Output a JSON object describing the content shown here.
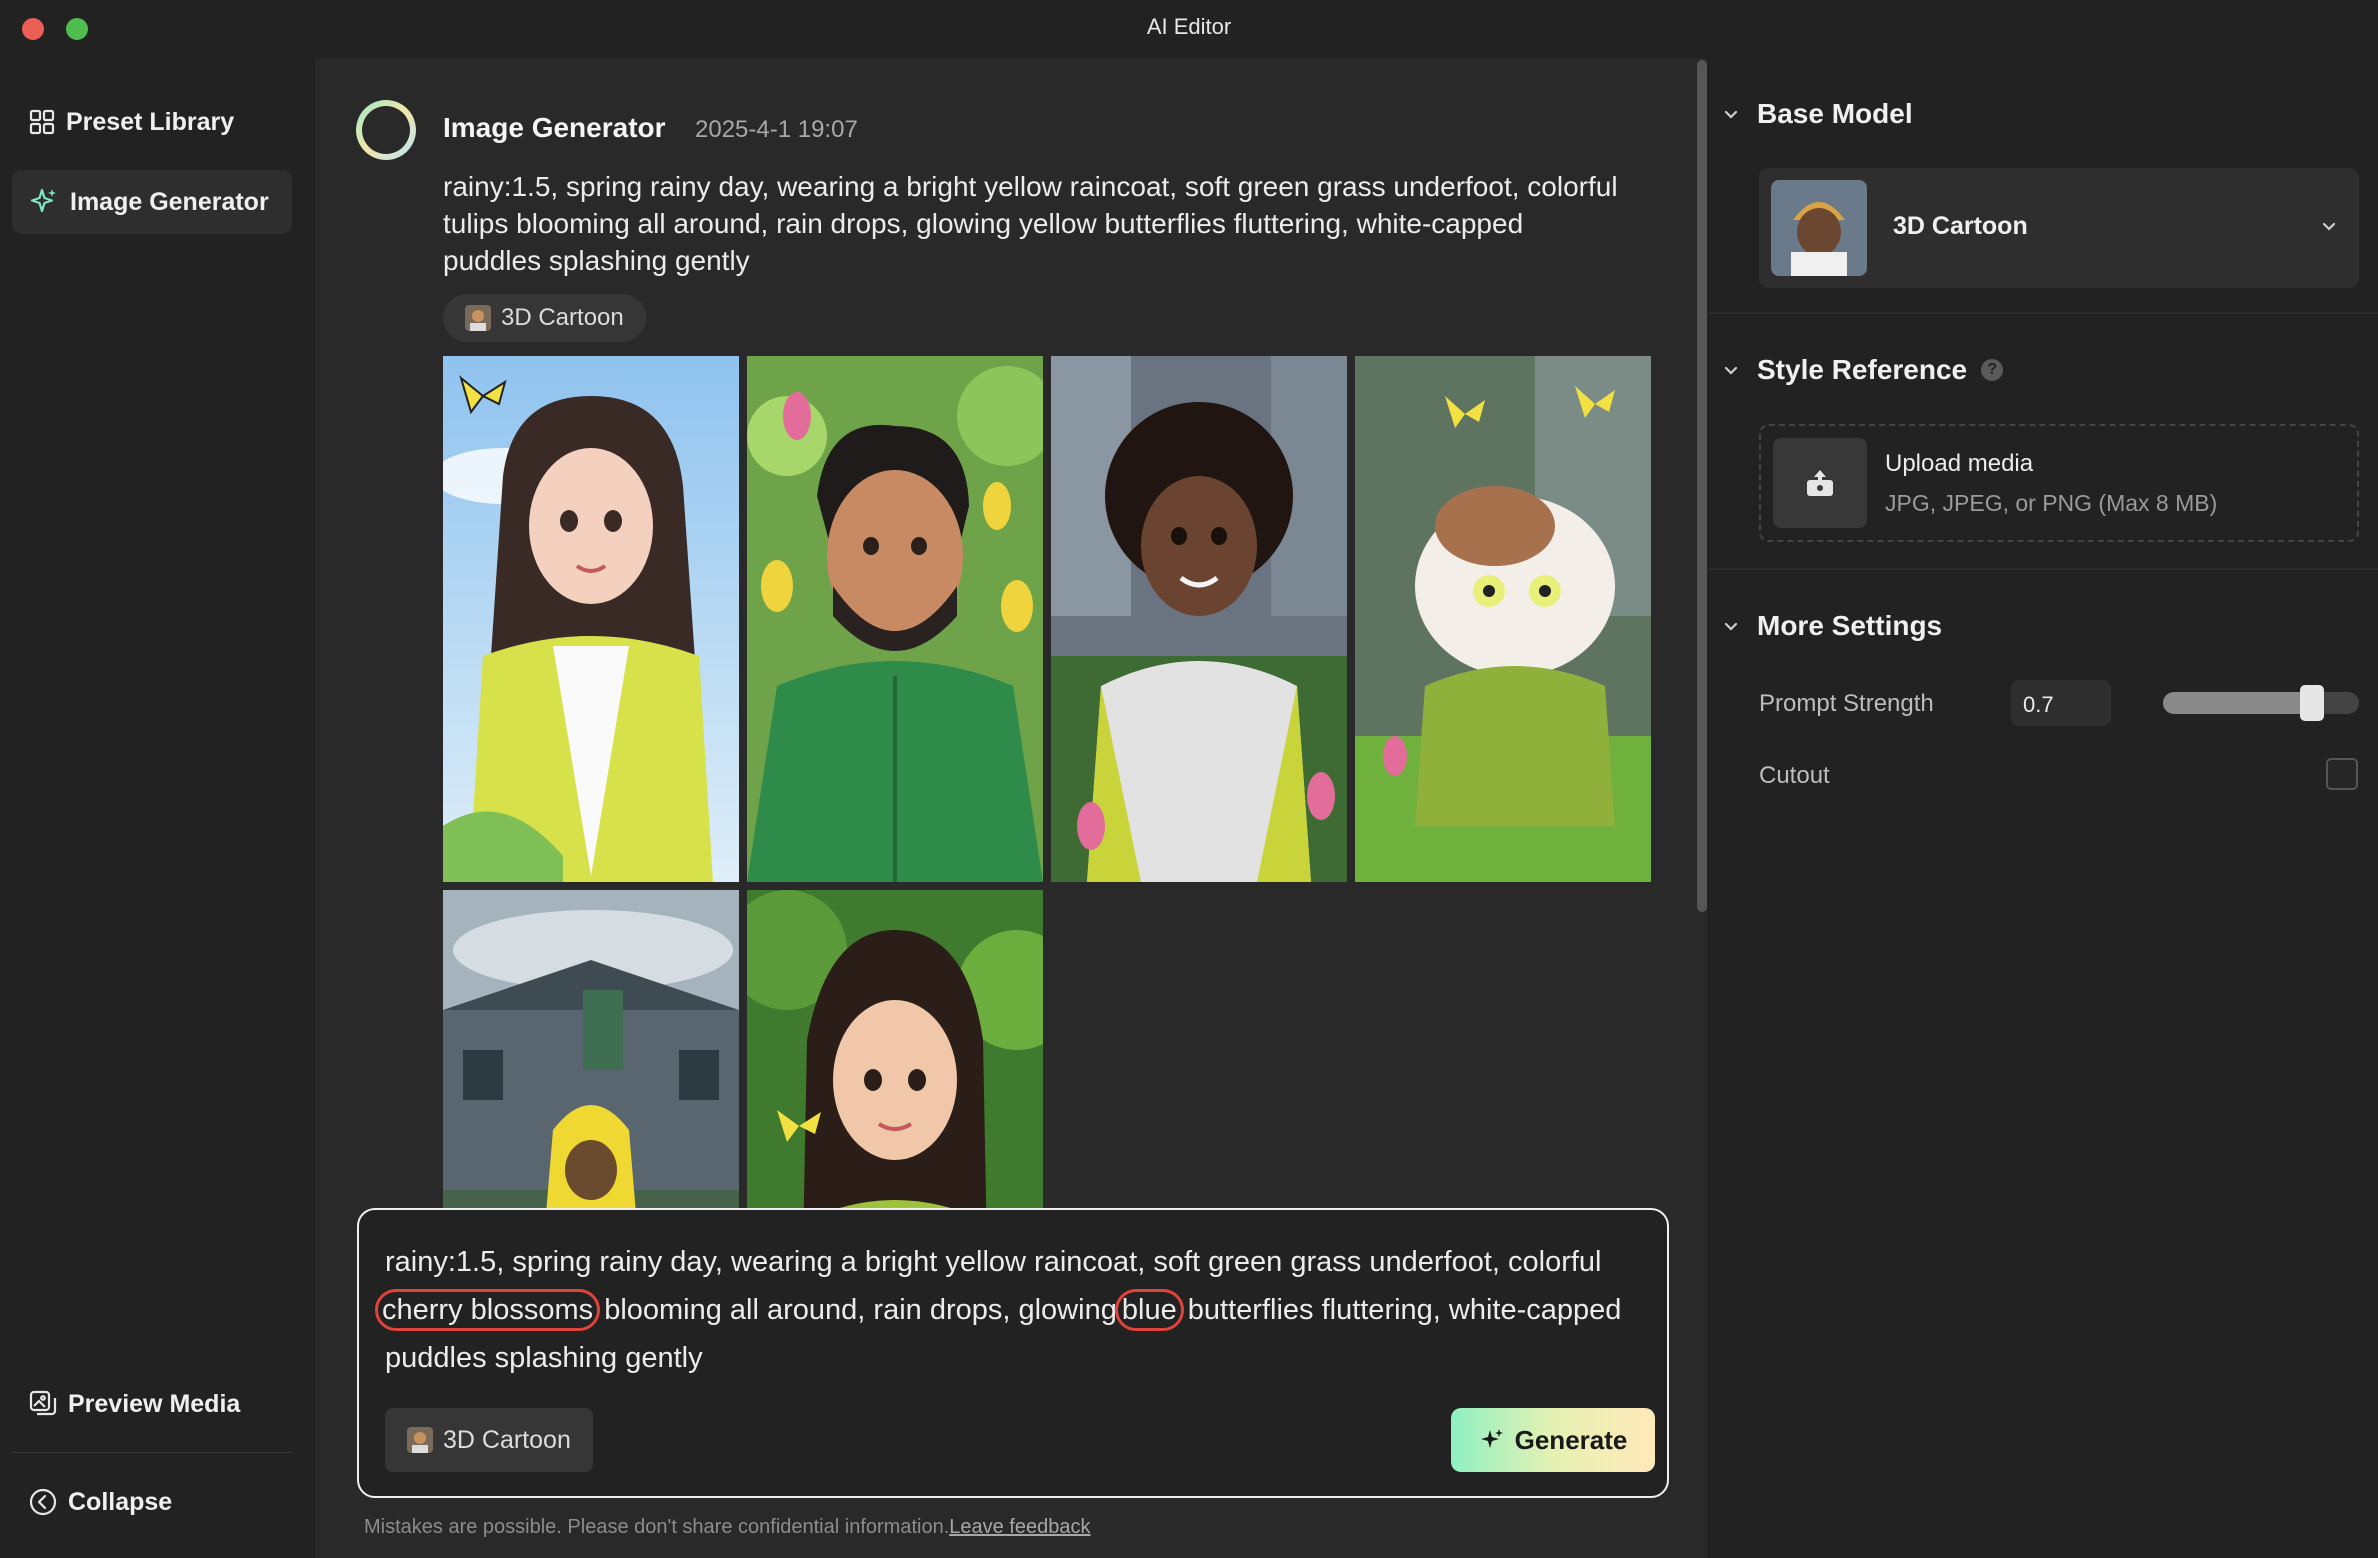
{
  "window": {
    "title": "AI Editor"
  },
  "sidebar": {
    "items": [
      {
        "label": "Preset Library",
        "icon": "grid-icon"
      },
      {
        "label": "Image Generator",
        "icon": "sparkle-icon",
        "active": true
      },
      {
        "label": "Preview Media",
        "icon": "images-icon"
      },
      {
        "label": "Collapse",
        "icon": "chevron-left-circle-icon"
      }
    ]
  },
  "generation": {
    "title": "Image Generator",
    "timestamp": "2025-4-1 19:07",
    "prompt": "rainy:1.5, spring rainy day, wearing a bright yellow raincoat, soft green grass underfoot, colorful tulips blooming all around, rain drops, glowing yellow butterflies fluttering, white-capped puddles splashing gently",
    "style_chip": "3D Cartoon",
    "images": [
      {
        "subject": "woman with long dark hair in yellow raincoat, butterfly"
      },
      {
        "subject": "bearded man in green hoodie, tulips"
      },
      {
        "subject": "woman with curly hair in white and yellow jacket"
      },
      {
        "subject": "fluffy cat in green jacket on grass"
      },
      {
        "subject": "figure in yellow raincoat in front of building"
      },
      {
        "subject": "woman with long hair in green, butterfly"
      }
    ]
  },
  "composer": {
    "prompt_part1": "rainy:1.5, spring rainy day, wearing a bright yellow raincoat, soft green grass underfoot, colorful",
    "highlight1": "cherry blossoms",
    "prompt_part2": "blooming all around, rain drops, glowing",
    "highlight2": "blue",
    "prompt_part3": "butterflies fluttering, white-capped puddles splashing gently",
    "style_chip": "3D Cartoon",
    "generate_label": "Generate",
    "highlight_color": "#e0433a"
  },
  "disclaimer": {
    "text": "Mistakes are possible. Please don't share confidential information.",
    "link": "Leave feedback"
  },
  "settings": {
    "base_model": {
      "title": "Base Model",
      "selected": "3D Cartoon"
    },
    "style_reference": {
      "title": "Style Reference",
      "help": "?",
      "upload_title": "Upload media",
      "upload_hint": "JPG, JPEG, or PNG (Max 8 MB)"
    },
    "more_settings": {
      "title": "More Settings",
      "prompt_strength_label": "Prompt Strength",
      "prompt_strength_value": "0.7",
      "slider_fraction": 0.7,
      "cutout_label": "Cutout",
      "cutout_checked": false
    }
  },
  "colors": {
    "accent_gradient_start": "#8ff0c2",
    "accent_gradient_end": "#ffe9b8",
    "background": "#222222",
    "panel": "#292929"
  }
}
